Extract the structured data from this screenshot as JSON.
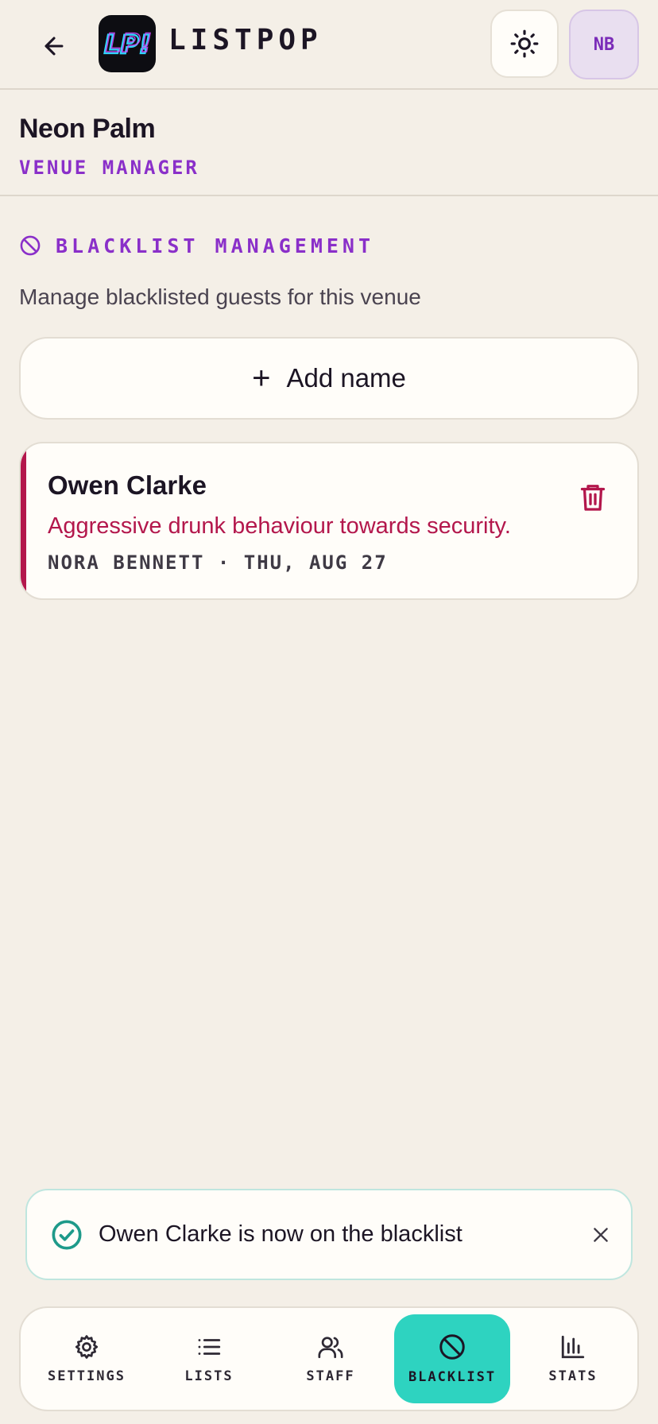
{
  "header": {
    "brand": "LISTPOP",
    "logo_text": "LP!",
    "avatar_initials": "NB"
  },
  "venue": {
    "name": "Neon Palm",
    "role": "VENUE MANAGER"
  },
  "section": {
    "title": "BLACKLIST MANAGEMENT",
    "description": "Manage blacklisted guests for this venue"
  },
  "add_button": {
    "label": "Add name"
  },
  "blacklist": [
    {
      "name": "Owen Clarke",
      "reason": "Aggressive drunk behaviour towards security.",
      "meta": "NORA BENNETT · THU, AUG 27"
    }
  ],
  "toast": {
    "message": "Owen Clarke is now on the blacklist"
  },
  "nav": {
    "items": [
      {
        "label": "SETTINGS",
        "icon": "gear-icon"
      },
      {
        "label": "LISTS",
        "icon": "list-icon"
      },
      {
        "label": "STAFF",
        "icon": "users-icon"
      },
      {
        "label": "BLACKLIST",
        "icon": "ban-icon",
        "active": true
      },
      {
        "label": "STATS",
        "icon": "bar-chart-icon"
      }
    ]
  },
  "colors": {
    "accent_purple": "#8a2fc9",
    "danger": "#b3174c",
    "active_teal": "#2ed3c0",
    "success": "#1e9a8a"
  }
}
